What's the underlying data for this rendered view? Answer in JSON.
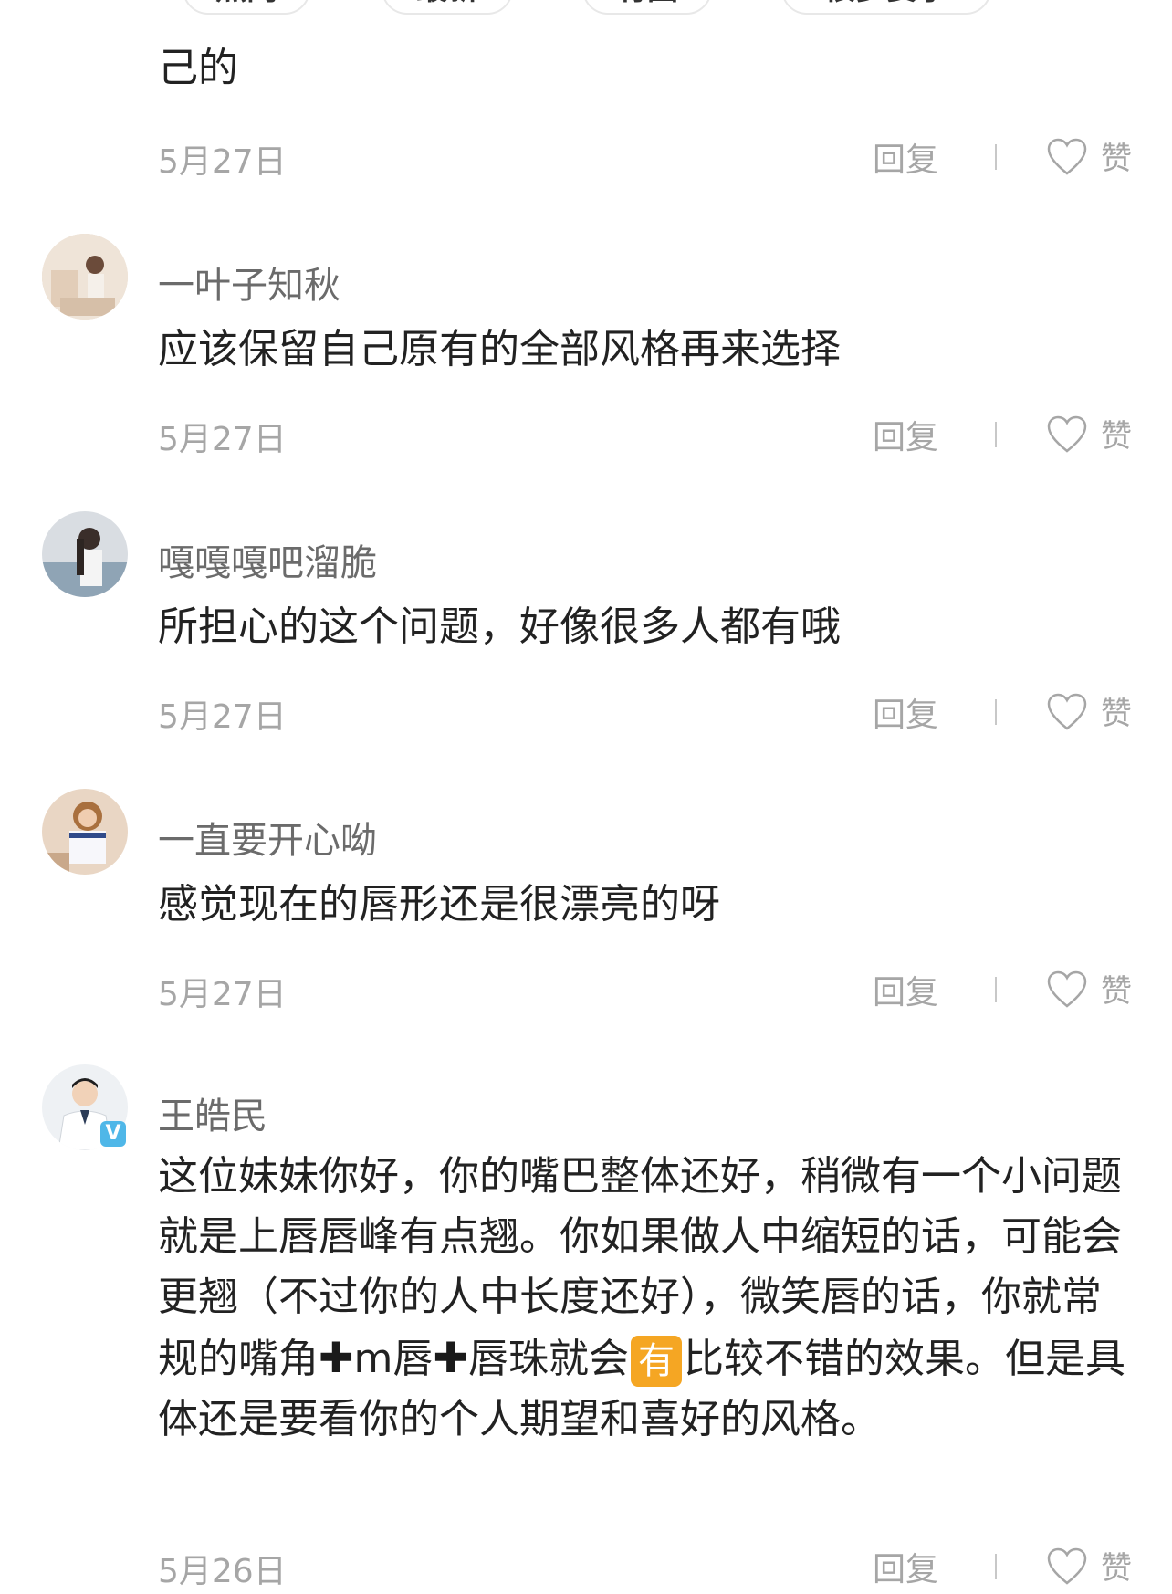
{
  "tabs": [
    {
      "label": "热门"
    },
    {
      "label": "最新"
    },
    {
      "label": "有图"
    },
    {
      "label": "很多要求"
    }
  ],
  "comments": [
    {
      "text": "己的",
      "date": "5月27日",
      "reply": "回复",
      "like": "赞"
    },
    {
      "username": "一叶子知秋",
      "text": "应该保留自己原有的全部风格再来选择",
      "date": "5月27日",
      "reply": "回复",
      "like": "赞"
    },
    {
      "username": "嘎嘎嘎吧溜脆",
      "text": "所担心的这个问题，好像很多人都有哦",
      "date": "5月27日",
      "reply": "回复",
      "like": "赞"
    },
    {
      "username": "一直要开心呦",
      "text": "感觉现在的唇形还是很漂亮的呀",
      "date": "5月27日",
      "reply": "回复",
      "like": "赞"
    },
    {
      "username": "王皓民",
      "verified": "V",
      "text_parts": {
        "p1": "这位妹妹你好，你的嘴巴整体还好，稍微有一个小问题就是上唇唇峰有点翘。你如果做人中缩短的话，可能会更翘（不过你的人中长度还好），微笑唇的话，你就常规的嘴角",
        "plus": "✚",
        "p2": "m唇",
        "p3": "唇珠就会",
        "badge": "有",
        "p4": "比较不错的效果。但是具体还是要看你的个人期望和喜好的风格。"
      },
      "date": "5月26日",
      "reply": "回复",
      "like": "赞"
    }
  ],
  "colors": {
    "meta_text": "#a6a6a6",
    "username": "#6b6b6b",
    "body_text": "#222222",
    "verified_badge": "#4fb7e8",
    "you_badge": "#f5a623"
  }
}
